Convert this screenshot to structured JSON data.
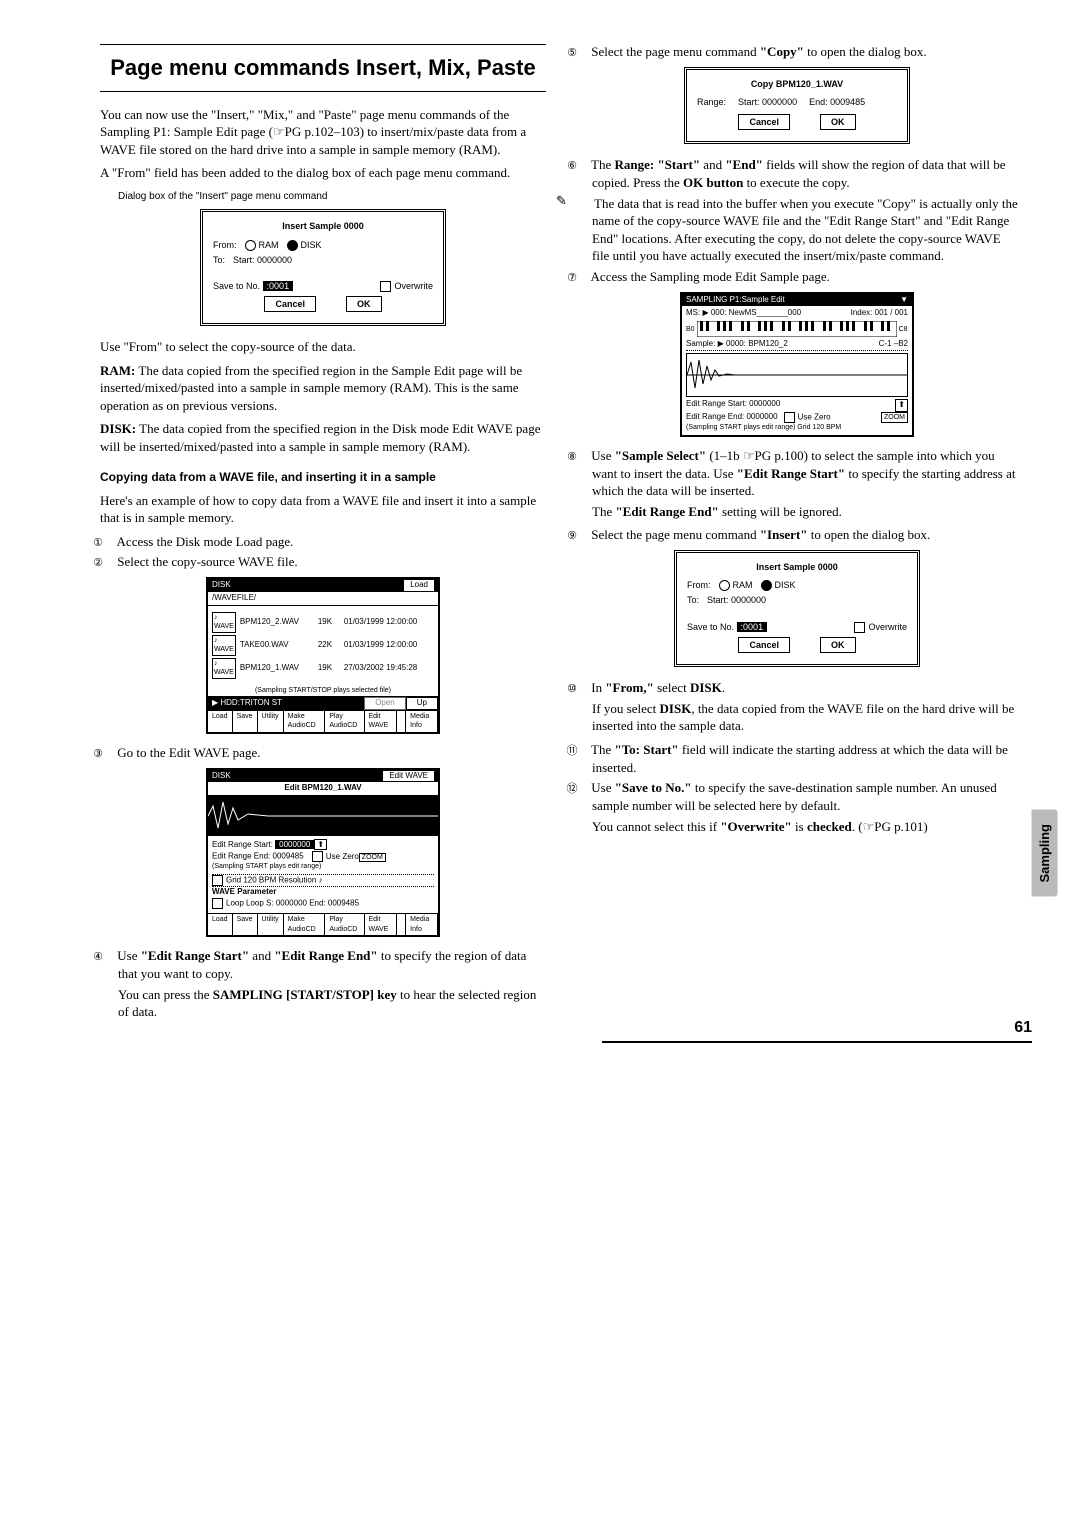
{
  "section_title": "Page menu commands Insert, Mix, Paste",
  "intro_p1": "You can now use the \"Insert,\" \"Mix,\" and \"Paste\" page menu commands of the Sampling P1: Sample Edit page (☞PG p.102–103) to insert/mix/paste data from a WAVE file stored on the hard drive into a sample in sample memory (RAM).",
  "intro_p2": "A \"From\" field has been added to the dialog box of each page menu command.",
  "caption1": "Dialog box of the \"Insert\" page menu command",
  "dialog1": {
    "title": "Insert Sample 0000",
    "from": "From:",
    "ram": "RAM",
    "disk": "DISK",
    "to": "To:",
    "start": "Start: 0000000",
    "save": "Save to No.",
    "saveval": ":0001",
    "over": "Overwrite",
    "cancel": "Cancel",
    "ok": "OK"
  },
  "from_para": "Use \"From\" to select the copy-source of the data.",
  "ram_para": "RAM: The data copied from the specified region in the Sample Edit page will be inserted/mixed/pasted into a sample in sample memory (RAM). This is the same operation as on previous versions.",
  "disk_para": "DISK: The data copied from the specified region in the Disk mode Edit WAVE page will be inserted/mixed/pasted into a sample in sample memory (RAM).",
  "sub1": "Copying data from a WAVE file, and inserting it in a sample",
  "sub1_intro": "Here's an example of how to copy data from a WAVE file and insert it into a sample that is in sample memory.",
  "step1": "Access the Disk mode Load page.",
  "step2": "Select the copy-source WAVE file.",
  "disk_screen": {
    "title": "DISK",
    "menu": "Load",
    "path": "/WAVEFILE/",
    "rows": [
      {
        "name": "BPM120_2.WAV",
        "size": "19K",
        "date": "01/03/1999 12:00:00"
      },
      {
        "name": "TAKE00.WAV",
        "size": "22K",
        "date": "01/03/1999 12:00:00"
      },
      {
        "name": "BPM120_1.WAV",
        "size": "19K",
        "date": "27/03/2002 19:45:28"
      }
    ],
    "footer": "(Sampling START/STOP plays selected file)",
    "drive": "HDD:TRITON ST",
    "open": "Open",
    "up": "Up",
    "tabs": [
      "Load",
      "Save",
      "Utility",
      "Make AudioCD",
      "Play AudioCD",
      "Edit WAVE",
      "",
      "Media Info"
    ]
  },
  "step3": "Go to the Edit WAVE page.",
  "editwave_screen": {
    "title": "DISK",
    "menu": "Edit WAVE",
    "file": "Edit BPM120_1.WAV",
    "ers": "Edit Range Start:",
    "ersv": "0000000",
    "ere": "Edit Range End:",
    "erev": "0009485",
    "usez": "Use Zero",
    "zoom": "ZOOM",
    "note": "(Sampling START plays edit range)",
    "grid": "Grid 120 BPM    Resolution ♪",
    "wave": "WAVE Parameter",
    "loop": "Loop   Loop S: 0000000        End: 0009485",
    "tabs": [
      "Load",
      "Save",
      "Utility",
      "Make AudioCD",
      "Play AudioCD",
      "Edit WAVE",
      "",
      "Media Info"
    ]
  },
  "step4": "Use \"Edit Range Start\" and \"Edit Range End\" to specify the region of data that you want to copy.",
  "step4b": "You can press the SAMPLING [START/STOP] key to hear the selected region of data.",
  "step5": "Select the page menu command \"Copy\" to open the dialog box.",
  "dialog_copy": {
    "title": "Copy BPM120_1.WAV",
    "range": "Range:",
    "start": "Start: 0000000",
    "end": "End: 0009485",
    "cancel": "Cancel",
    "ok": "OK"
  },
  "step6": "The Range: \"Start\" and \"End\" fields will show the region of data that will be copied. Press the OK button to execute the copy.",
  "note1": "The data that is read into the buffer when you execute \"Copy\" is actually only the name of the copy-source WAVE file and the \"Edit Range Start\" and \"Edit Range End\" locations. After executing the copy, do not delete the copy-source WAVE file until you have actually executed the insert/mix/paste command.",
  "step7": "Access the Sampling mode Edit Sample page.",
  "sampling_screen": {
    "title": "SAMPLING P1:Sample Edit",
    "ms": "MS: ▶ 000: NewMS_______000",
    "index": "Index: 001  / 001",
    "kb_lo": "B0",
    "kb_hi": "C8",
    "sample": "Sample: ▶ 0000: BPM120_2",
    "range": "C-1 –B2",
    "ers": "Edit Range Start:  0000000",
    "ere": "Edit Range End:    0000000",
    "usez": "Use Zero",
    "zoom": "ZOOM",
    "foot": "(Sampling START plays edit range)  Grid 120 BPM"
  },
  "step8a": "Use \"Sample Select\" (1–1b ☞PG p.100) to select the sample into which you want to insert the data. Use \"Edit Range Start\" to specify the starting address at which the data will be inserted.",
  "step8b": "The \"Edit Range End\" setting will be ignored.",
  "step9": "Select the page menu command \"Insert\" to open the dialog box.",
  "dialog2": {
    "title": "Insert Sample 0000",
    "from": "From:",
    "ram": "RAM",
    "disk": "DISK",
    "to": "To:",
    "start": "Start: 0000000",
    "save": "Save to No.",
    "saveval": ":0001",
    "over": "Overwrite",
    "cancel": "Cancel",
    "ok": "OK"
  },
  "step10a": "In \"From,\" select DISK.",
  "step10b": "If you select DISK, the data copied from the WAVE file on the hard drive will be inserted into the sample data.",
  "step11": "The \"To: Start\" field will indicate the starting address at which the data will be inserted.",
  "step12a": "Use \"Save to No.\" to specify the save-destination sample number. An unused sample number will be selected here by default.",
  "step12b": "You cannot select this if \"Overwrite\" is checked. (☞PG p.101)",
  "side_tab": "Sampling",
  "page_num": "61"
}
